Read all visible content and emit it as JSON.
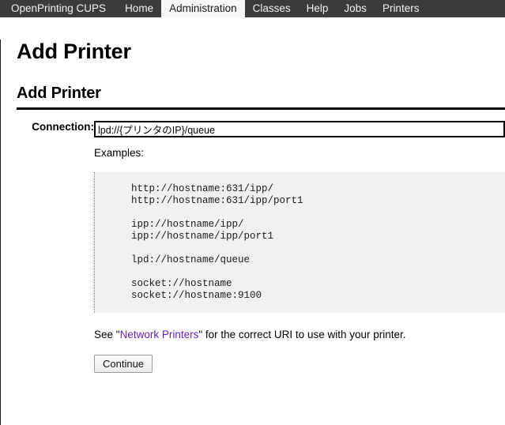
{
  "nav": {
    "brand": "OpenPrinting CUPS",
    "items": [
      {
        "label": "Home",
        "active": false
      },
      {
        "label": "Administration",
        "active": true
      },
      {
        "label": "Classes",
        "active": false
      },
      {
        "label": "Help",
        "active": false
      },
      {
        "label": "Jobs",
        "active": false
      },
      {
        "label": "Printers",
        "active": false
      }
    ]
  },
  "page": {
    "title": "Add Printer",
    "section_title": "Add Printer"
  },
  "form": {
    "connection_label": "Connection:",
    "connection_value": "lpd://{プリンタのIP}/queue",
    "examples_label": "Examples:",
    "examples": [
      "http://hostname:631/ipp/",
      "http://hostname:631/ipp/port1",
      "",
      "ipp://hostname/ipp/",
      "ipp://hostname/ipp/port1",
      "",
      "lpd://hostname/queue",
      "",
      "socket://hostname",
      "socket://hostname:9100"
    ],
    "see_prefix": "See \"",
    "link_text": "Network Printers",
    "see_suffix": "\" for the correct URI to use with your printer.",
    "continue_label": "Continue"
  },
  "colors": {
    "nav_background": "#3b3b3b",
    "nav_text": "#f2f2f2",
    "active_tab_background": "#f7f7f7",
    "examples_background": "#f1f1f1",
    "link": "#6a22b5"
  }
}
